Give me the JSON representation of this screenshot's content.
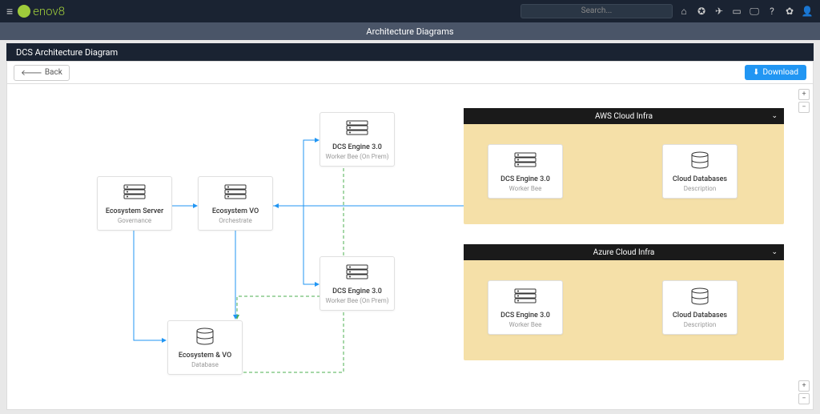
{
  "app": {
    "name": "enov8"
  },
  "search": {
    "placeholder": "Search..."
  },
  "subheader": {
    "title": "Architecture Diagrams"
  },
  "page": {
    "title": "DCS Architecture Diagram"
  },
  "buttons": {
    "back": "Back",
    "download": "Download"
  },
  "nodes": {
    "eco_server": {
      "title": "Ecosystem Server",
      "sub": "Governance"
    },
    "eco_vo": {
      "title": "Ecosystem VO",
      "sub": "Orchestrate"
    },
    "eco_db": {
      "title": "Ecosystem & VO",
      "sub": "Database"
    },
    "dcs_onprem1": {
      "title": "DCS Engine 3.0",
      "sub": "Worker Bee (On Prem)"
    },
    "dcs_onprem2": {
      "title": "DCS Engine 3.0",
      "sub": "Worker Bee (On Prem)"
    },
    "dcs_aws": {
      "title": "DCS Engine 3.0",
      "sub": "Worker Bee"
    },
    "db_aws": {
      "title": "Cloud Databases",
      "sub": "Description"
    },
    "dcs_azure": {
      "title": "DCS Engine 3.0",
      "sub": "Worker Bee"
    },
    "db_azure": {
      "title": "Cloud Databases",
      "sub": "Description"
    }
  },
  "groups": {
    "aws": {
      "title": "AWS Cloud Infra"
    },
    "azure": {
      "title": "Azure Cloud Infra"
    }
  },
  "colors": {
    "accent": "#2196F3",
    "green": "#4CAF50",
    "orange": "#FF9800"
  }
}
